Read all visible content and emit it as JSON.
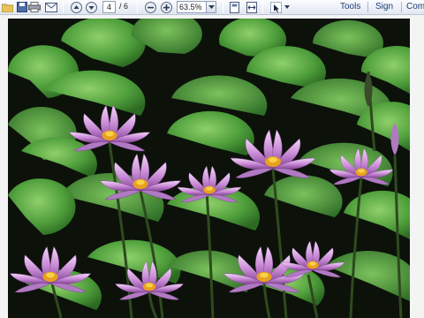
{
  "toolbar": {
    "page_current": "4",
    "page_total_label": "/ 6",
    "zoom_value": "63.5%",
    "menu_tools": "Tools",
    "menu_sign": "Sign",
    "menu_comment": "Com"
  },
  "icons": [
    "folder-icon",
    "print-icon",
    "email-icon",
    "page-up-icon",
    "page-down-icon",
    "zoom-out-icon",
    "zoom-in-icon",
    "fit-page-icon",
    "fit-width-icon",
    "select-tool-icon"
  ],
  "colors": {
    "toolbar_text": "#1a3c78",
    "lily_petal": "#c98bd6",
    "lily_center": "#e8a020",
    "lily_pad": "#5fb04a",
    "background": "#0c120a"
  }
}
